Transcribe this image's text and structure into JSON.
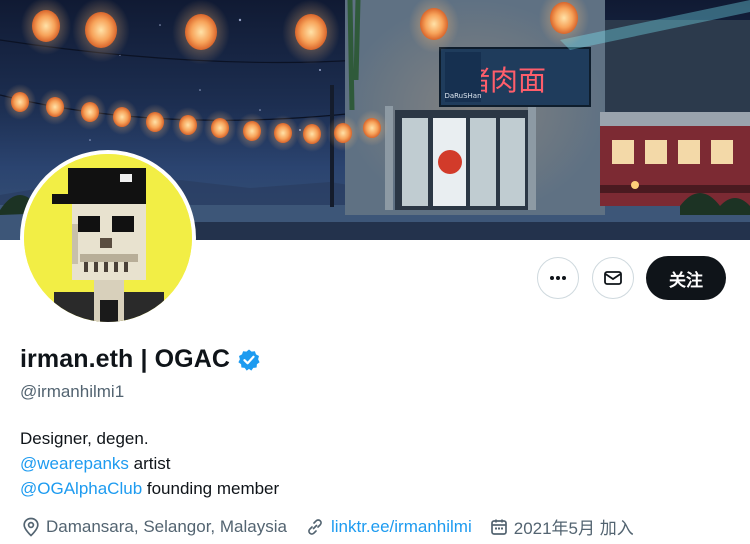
{
  "profile": {
    "display_name": "irman.eth | OGAC",
    "handle": "@irmanhilmi1",
    "verified": true,
    "bio": {
      "line1": "Designer, degen.",
      "mention1": "@wearepanks",
      "mention1_suffix": " artist",
      "mention2": "@OGAlphaClub",
      "mention2_suffix": " founding member"
    },
    "location": "Damansara, Selangor, Malaysia",
    "website": "linktr.ee/irmanhilmi",
    "joined": "2021年5月 加入"
  },
  "actions": {
    "more_icon": "more-dots-icon",
    "message_icon": "mail-icon",
    "follow_label": "关注"
  },
  "banner": {
    "sign_text": "猪肉面",
    "small_sign": "DaRuSHan"
  },
  "colors": {
    "accent": "#1d9bf0",
    "text": "#0f1419",
    "secondary": "#536471",
    "follow_bg": "#0f1419",
    "avatar_bg": "#f2ee45"
  }
}
